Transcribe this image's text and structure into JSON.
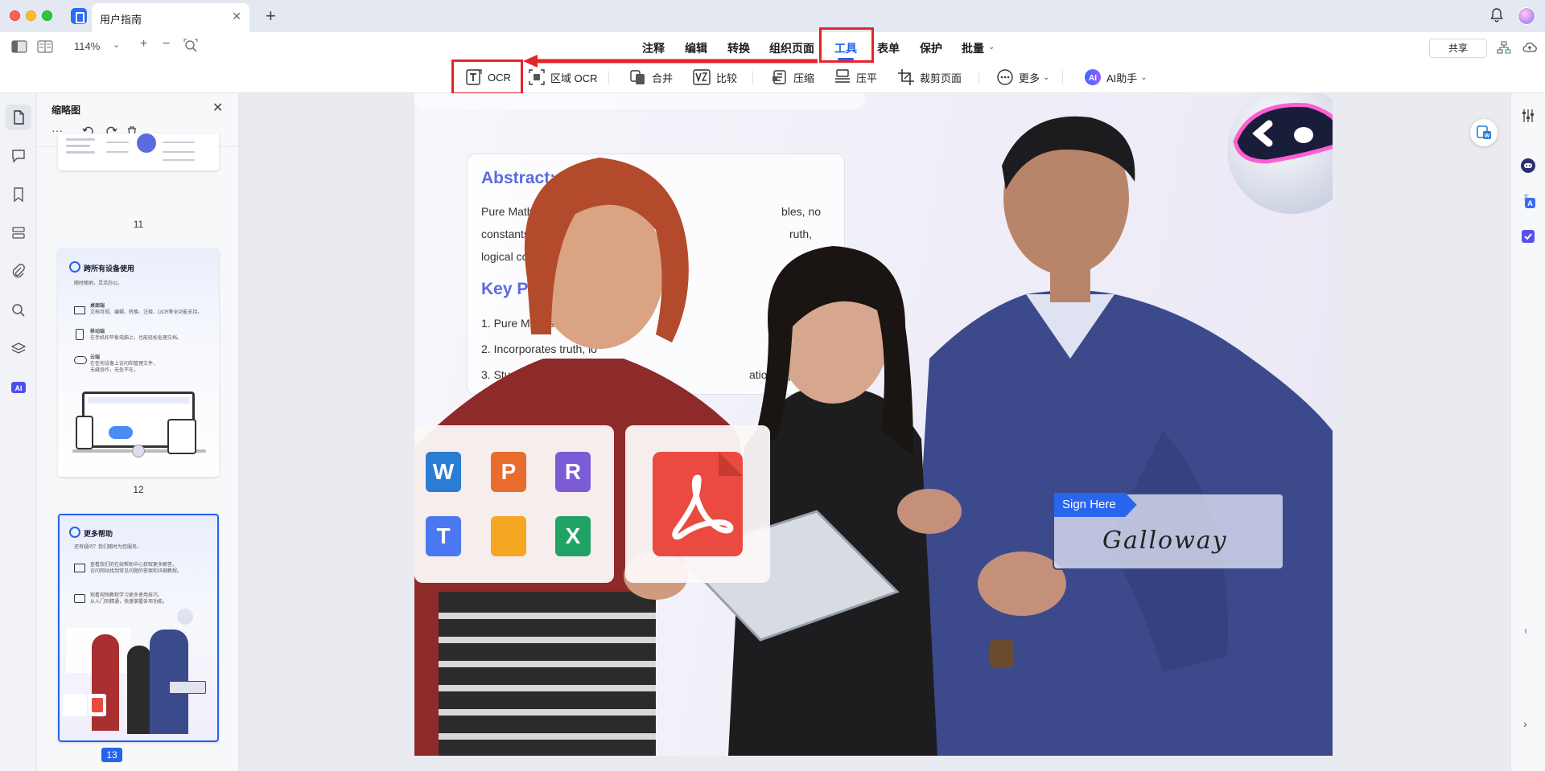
{
  "window": {
    "tab_title": "用户指南",
    "tab_close": "✕",
    "tab_add": "+"
  },
  "toolbar": {
    "zoom": "114%",
    "zoom_chevron": "⌄",
    "plus": "+",
    "minus": "−",
    "menus": [
      "注释",
      "编辑",
      "转换",
      "组织页面",
      "工具",
      "表单",
      "保护",
      "批量"
    ],
    "active_menu": "工具",
    "share": "共享"
  },
  "tools": {
    "ocr": "OCR",
    "area_ocr": "区域 OCR",
    "merge": "合并",
    "compare": "比较",
    "compress": "压缩",
    "flatten": "压平",
    "crop": "裁剪页面",
    "more": "更多",
    "ai": "AI助手"
  },
  "thumbnails": {
    "title": "缩略图",
    "close": "✕",
    "more": "···",
    "pages": [
      "11",
      "12",
      "13"
    ],
    "active_page": "13",
    "page12": {
      "heading": "跨所有设备使用",
      "sub": "随时随地，灵活办公。",
      "items": [
        {
          "title": "桌面端",
          "desc": "文档可视、编辑、转换、注释、OCR等全功能支持。"
        },
        {
          "title": "移动端",
          "desc": "在手机和平板电脑上，也能轻松处理文档。"
        },
        {
          "title": "云端",
          "desc": "在任何设备上访问和管理文件，\n无缝协作，无处不在。"
        }
      ]
    },
    "page13": {
      "heading": "更多帮助",
      "sub": "还有疑问？我们随时为您服务。",
      "items": [
        {
          "desc": "查看我们的在线帮助中心获取更多解答，\n访问网站找到常见问题的答案和详细教程。"
        },
        {
          "desc": "观看视频教程学习更多使用技巧，\n从入门到精通，快速掌握各项功能。"
        }
      ]
    }
  },
  "document": {
    "abstract_heading": "Abstract:",
    "abstract_text": "Pure Mathematics studies abstract variables, no constants except logical truth, logical constants.",
    "abstract_l1": "Pure Mathematics studies '",
    "abstract_l1b": "bles, no",
    "abstract_l2": "constants except logical",
    "abstract_l2b": "ruth,",
    "abstract_l3": "logical constants.",
    "keypoints_heading": "Key Points:",
    "kp1": "1. Pure Math studies 'p",
    "kp2": "2. Incorporates truth, lo",
    "kp2b": "co",
    "kp3": "3. Stu",
    "kp3b": "ationships.",
    "app_icons": [
      "W",
      "P",
      "R",
      "T",
      "",
      "X"
    ],
    "sign_tag": "Sign Here",
    "signature": "Galloway"
  },
  "colors": {
    "accent": "#2563eb",
    "highlight": "#e5232a",
    "word": "#2b7cd3",
    "powerpoint": "#e86c2e",
    "reader": "#7b5bd6",
    "text": "#4a78f0",
    "pages": "#f5a623",
    "excel": "#21a366",
    "pdf": "#ea4a40"
  },
  "icons": [
    "sidebar-toggle-icon",
    "grid-view-icon",
    "zoom-fit-icon",
    "bell-icon",
    "cloud-upload-icon",
    "org-icon",
    "ocr-icon",
    "area-ocr-icon",
    "merge-icon",
    "compare-icon",
    "compress-icon",
    "flatten-icon",
    "crop-icon",
    "more-icon",
    "ai-icon",
    "page-icon",
    "comment-icon",
    "bookmark-icon",
    "fields-icon",
    "attachment-icon",
    "search-icon",
    "layers-icon",
    "ai-rail-icon",
    "sliders-icon",
    "chatbot-icon",
    "translate-icon",
    "checklist-icon",
    "rotate-left-icon",
    "rotate-right-icon",
    "trash-icon"
  ]
}
